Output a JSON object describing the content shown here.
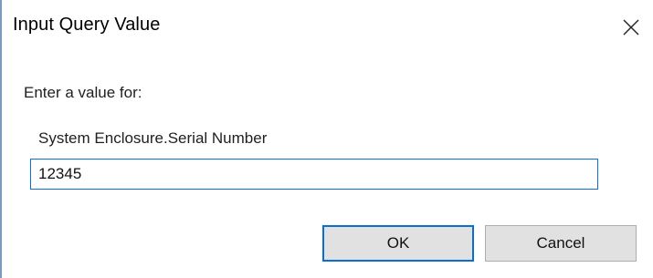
{
  "window": {
    "title": "Input Query Value",
    "close_icon": "close-icon"
  },
  "form": {
    "prompt": "Enter a value for:",
    "field_label": "System Enclosure.Serial Number",
    "input_value": "12345"
  },
  "buttons": {
    "ok_label": "OK",
    "cancel_label": "Cancel"
  },
  "colors": {
    "accent": "#0a70d0",
    "button_face": "#e1e1e1",
    "button_border": "#adadad"
  }
}
